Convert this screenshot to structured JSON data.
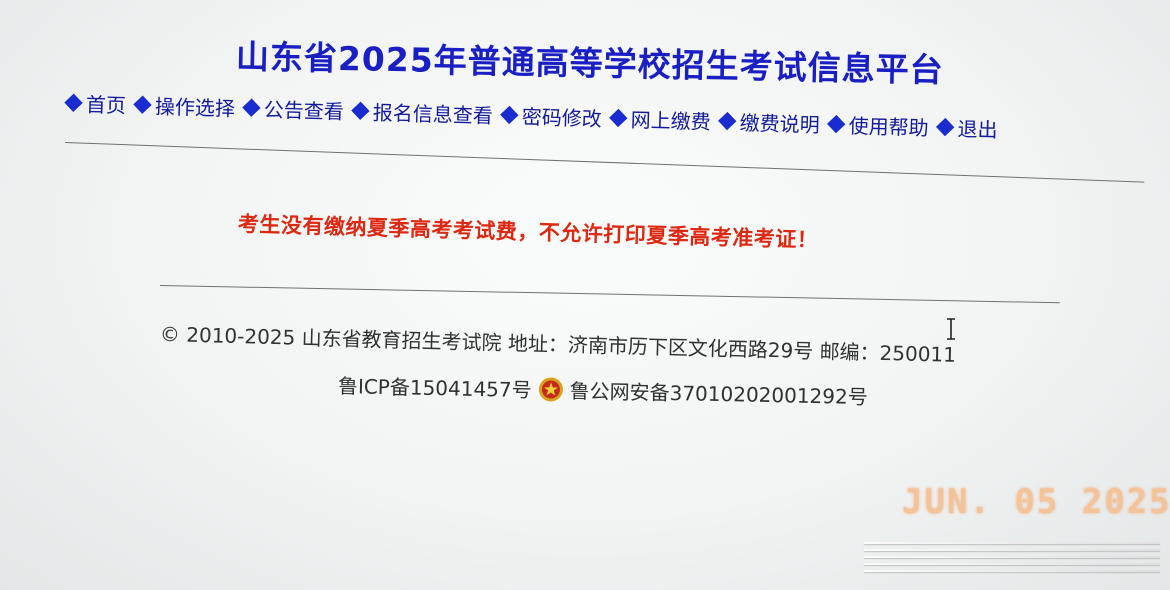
{
  "header": {
    "title": "山东省2025年普通高等学校招生考试信息平台"
  },
  "nav": {
    "items": [
      {
        "label": "首页",
        "icon": "diamond-icon"
      },
      {
        "label": "操作选择",
        "icon": "diamond-icon"
      },
      {
        "label": "公告查看",
        "icon": "diamond-icon"
      },
      {
        "label": "报名信息查看",
        "icon": "diamond-icon"
      },
      {
        "label": "密码修改",
        "icon": "diamond-icon"
      },
      {
        "label": "网上缴费",
        "icon": "diamond-icon"
      },
      {
        "label": "缴费说明",
        "icon": "diamond-icon"
      },
      {
        "label": "使用帮助",
        "icon": "diamond-icon"
      },
      {
        "label": "退出",
        "icon": "diamond-icon"
      }
    ]
  },
  "main": {
    "warning": "考生没有缴纳夏季高考考试费，不允许打印夏季高考准考证！"
  },
  "footer": {
    "copyright": "© 2010-2025 山东省教育招生考试院 地址：济南市历下区文化西路29号 邮编：250011",
    "icp": "鲁ICP备15041457号",
    "police_record": "鲁公网安备37010202001292号",
    "emblem_icon": "police-emblem-icon"
  },
  "photo": {
    "date_stamp": "JUN. 05 2025"
  },
  "colors": {
    "title": "#1a1fc4",
    "nav": "#141a9c",
    "warning": "#dd2812",
    "footer": "#2e3232",
    "date_stamp": "#f3c39a"
  }
}
